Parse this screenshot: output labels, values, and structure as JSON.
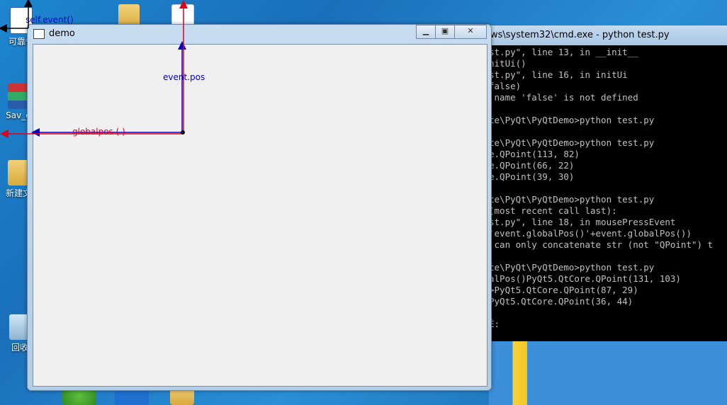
{
  "desktop": {
    "icons": [
      {
        "label": "可靠性",
        "icon": "word-document-icon"
      },
      {
        "label": "Sav_d",
        "icon": "winrar-archive-icon"
      },
      {
        "label": "新建文",
        "icon": "folder-icon"
      },
      {
        "label": "回收",
        "icon": "recycle-bin-icon"
      }
    ]
  },
  "demo_window": {
    "title": "demo",
    "minimize_label": "▁",
    "maximize_label": "▣",
    "close_label": "✕"
  },
  "annotations": {
    "self_event": "self.event()",
    "event_pos": "event.pos",
    "global_pos": "globalpos ( )",
    "colors": {
      "event_pos": "#0000cc",
      "global_pos": "#e0001b",
      "self_event": "#0000cc"
    }
  },
  "cmd_window": {
    "title": "ws\\system32\\cmd.exe - python  test.py",
    "lines": [
      "st.py\", line 13, in __init__",
      "nitUi()",
      "st.py\", line 16, in initUi",
      "false)",
      " name 'false' is not defined",
      "",
      "ce\\PyQt\\PyQtDemo>python test.py",
      "",
      "ce\\PyQt\\PyQtDemo>python test.py",
      "e.QPoint(113, 82)",
      "e.QPoint(66, 22)",
      "e.QPoint(39, 30)",
      "",
      "ce\\PyQt\\PyQtDemo>python test.py",
      "(most recent call last):",
      "st.py\", line 18, in mousePressEvent",
      "'event.globalPos()'+event.globalPos())",
      " can only concatenate str (not \"QPoint\") t",
      "",
      "ce\\PyQt\\PyQtDemo>python test.py",
      "alPos()PyQt5.QtCore.QPoint(131, 103)",
      ">PyQt5.QtCore.QPoint(87, 29)",
      "PyQt5.QtCore.QPoint(36, 44)",
      "",
      "É:"
    ]
  }
}
